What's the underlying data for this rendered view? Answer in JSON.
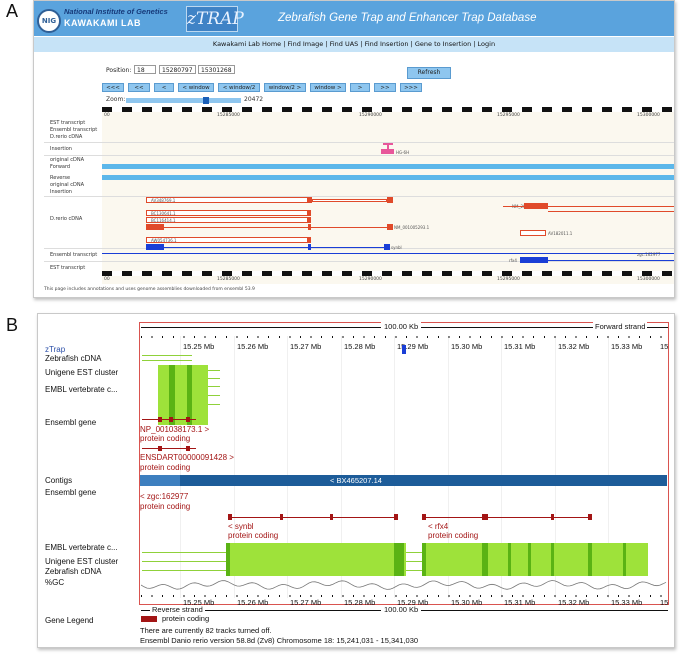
{
  "panel_a": {
    "letter": "A",
    "header": {
      "logo_text": "NIG",
      "institute": "National Institute of Genetics",
      "lab": "KAWAKAMI LAB",
      "app_logo": "zTRAP",
      "title": "Zebrafish Gene Trap and Enhancer Trap Database"
    },
    "nav_text": "Kawakami Lab Home | Find Image | Find UAS | Find Insertion | Gene to Insertion | Login",
    "position": {
      "label": "Position:",
      "chromosome": "18",
      "start": "15280797",
      "end": "15301268"
    },
    "refresh_label": "Refresh",
    "nav_buttons": [
      "<<<",
      "<<",
      "<",
      "< window",
      "< window/2",
      "window/2 >",
      "window >",
      ">",
      ">>",
      ">>>"
    ],
    "zoom": {
      "label": "Zoom:",
      "value": "20472"
    },
    "ruler_ticks": [
      "00",
      "15285000",
      "15290000",
      "15295000",
      "15300000"
    ],
    "track_labels": {
      "est": "EST transcript",
      "ensembl": "Ensembl transcript",
      "drerio_cdna": "D.rerio cDNA",
      "insertion": "Insertion",
      "original_cdna": "original cDNA",
      "forward": "Forward",
      "reverse": "Reverse",
      "original_cdna2": "original cDNA",
      "insertion2": "Insertion",
      "drerio_cdna2": "D.rerio cDNA",
      "ensembl2": "Ensembl transcript",
      "est2": "EST transcript"
    },
    "features": {
      "insertion": "HG-6H",
      "nm1": "NM_205712.1",
      "nm2": "NM_001005293.1",
      "bc_a": "AV348769.1",
      "bc_b": "BC130641.1",
      "bc_c": "BC116414.1",
      "bc_d": "AW054736.1",
      "av": "AV182011.1",
      "synbl": "synbl",
      "zgc": "zgc:162977",
      "rfx4": "rfx4"
    },
    "footer": "This page includes annotations and uses genome assemblies downloaded from ensembl 53.9"
  },
  "panel_b": {
    "letter": "B",
    "top_scale": "100.00 Kb",
    "forward_strand": "Forward strand",
    "reverse_strand": "Reverse strand",
    "bottom_scale": "100.00 Kb",
    "ticks": [
      "15.25 Mb",
      "15.26 Mb",
      "15.27 Mb",
      "15.28 Mb",
      "15.29 Mb",
      "15.30 Mb",
      "15.31 Mb",
      "15.32 Mb",
      "15.33 Mb",
      "15"
    ],
    "labels": {
      "ztrap": "zTrap",
      "zcdna": "Zebrafish cDNA",
      "unigene": "Unigene EST cluster",
      "embl": "EMBL vertebrate c...",
      "ensembl_gene": "Ensembl gene",
      "contigs": "Contigs",
      "ensembl_gene2": "Ensembl gene",
      "embl2": "EMBL vertebrate c...",
      "unigene2": "Unigene EST cluster",
      "zcdna2": "Zebrafish cDNA",
      "gc": "%GC",
      "legend": "Gene Legend"
    },
    "genes": {
      "np_name": "NP_001038173.1 >",
      "np_type": "protein coding",
      "ens_name": "ENSDART00000091428 >",
      "ens_type": "protein coding",
      "zgc_name": "< zgc:162977",
      "zgc_type": "protein coding",
      "synbl_name": "< synbl",
      "synbl_type": "protein coding",
      "rfx4_name": "< rfx4",
      "rfx4_type": "protein coding"
    },
    "contig_label": "< BX465207.14",
    "legend_item": "protein coding",
    "footer_tracks": "There are currently 82 tracks turned off.",
    "footer_version": "Ensembl Danio rerio version 58.8d (Zv8) Chromosome 18: 15,241,031 - 15,341,030",
    "colors": {
      "gene_red": "#a31515",
      "contig_blue": "#1d5c99",
      "est_green": "#9ee23a"
    }
  }
}
